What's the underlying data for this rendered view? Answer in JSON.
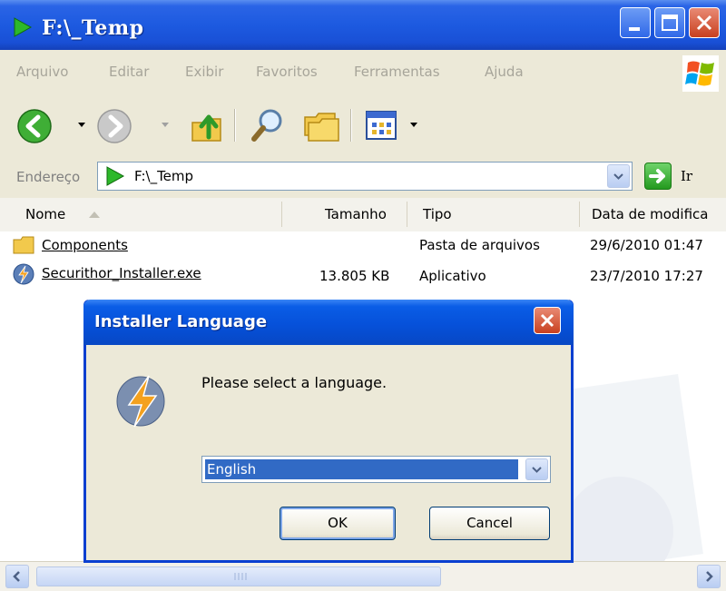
{
  "window": {
    "title": "F:\\_Temp",
    "menu": [
      "Arquivo",
      "Editar",
      "Exibir",
      "Favoritos",
      "Ferramentas",
      "Ajuda"
    ]
  },
  "address": {
    "label": "Endereço",
    "value": "F:\\_Temp",
    "go_label": "Ir"
  },
  "columns": {
    "name": "Nome",
    "size": "Tamanho",
    "type": "Tipo",
    "date": "Data de modifica"
  },
  "files": [
    {
      "name": "Components",
      "size": "",
      "type": "Pasta de arquivos",
      "date": "29/6/2010 01:47",
      "icon": "folder-icon"
    },
    {
      "name": "Securithor_Installer.exe",
      "size": "13.805 KB",
      "type": "Aplicativo",
      "date": "23/7/2010 17:27",
      "icon": "installer-icon"
    }
  ],
  "dialog": {
    "title": "Installer Language",
    "prompt": "Please select a language.",
    "selected_language": "English",
    "ok_label": "OK",
    "cancel_label": "Cancel"
  },
  "colors": {
    "titlebar": "#1d5ae0",
    "chrome": "#ece9d8",
    "selection": "#316ac5"
  }
}
